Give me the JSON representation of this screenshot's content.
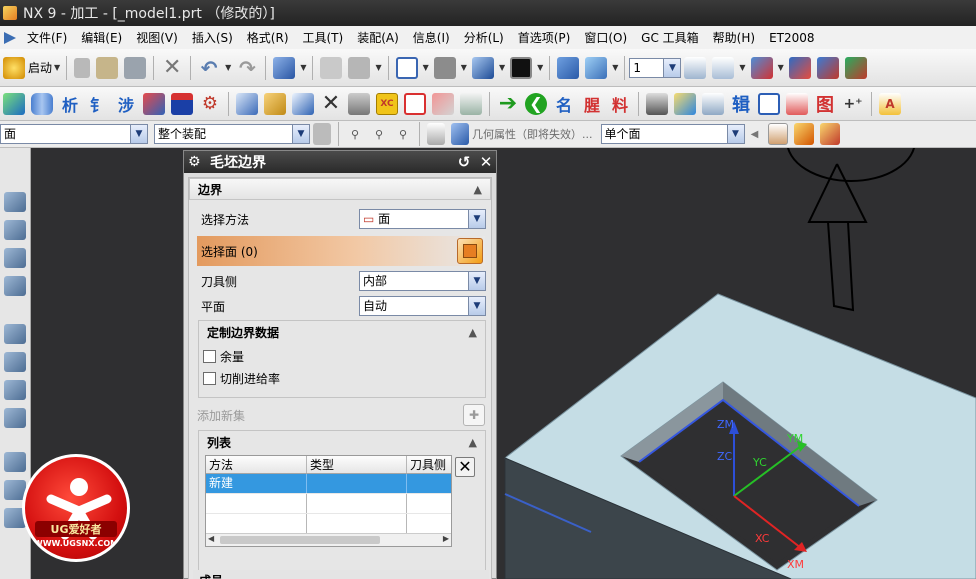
{
  "window": {
    "title": "NX 9 - 加工 - [_model1.prt （修改的）]"
  },
  "menu": {
    "items": [
      "文件(F)",
      "编辑(E)",
      "视图(V)",
      "插入(S)",
      "格式(R)",
      "工具(T)",
      "装配(A)",
      "信息(I)",
      "分析(L)",
      "首选项(P)",
      "窗口(O)",
      "GC 工具箱",
      "帮助(H)",
      "ET2008"
    ]
  },
  "toolbar1": {
    "start_label": "启动",
    "layer_value": "1"
  },
  "toolbar2": {
    "glyphs": [
      "析",
      "钅",
      "涉",
      "名",
      "腥",
      "料"
    ]
  },
  "selbar": {
    "filter_value": "面",
    "scope_value": "整个装配",
    "hint_text": "几何属性（即将失效）...",
    "face_rule_value": "单个面"
  },
  "dialog": {
    "title": "毛坯边界",
    "boundary_section": "边界",
    "select_method_label": "选择方法",
    "select_method_value": "面",
    "select_face_label": "选择面 (0)",
    "tool_side_label": "刀具侧",
    "tool_side_value": "内部",
    "plane_label": "平面",
    "plane_value": "自动",
    "custom_section": "定制边界数据",
    "allowance_label": "余量",
    "feed_label": "切削进给率",
    "add_set_label": "添加新集",
    "list_section": "列表",
    "columns": [
      "方法",
      "类型",
      "刀具侧"
    ],
    "rows": [
      [
        "新建",
        "",
        ""
      ]
    ],
    "bottom_section": "成员"
  },
  "viewport": {
    "axes": {
      "zm": "ZM",
      "zc": "ZC",
      "ym": "YM",
      "yc": "YC",
      "xc": "XC",
      "xm": "XM"
    }
  },
  "watermark": {
    "brand": "UG爱好者",
    "url": "WWW.UGSNX.COM"
  },
  "colors": {
    "accent_orange": "#e69a5c",
    "selection_blue": "#3498e0",
    "part_face": "#c5dde5",
    "title_dark": "#2a2a2a"
  }
}
